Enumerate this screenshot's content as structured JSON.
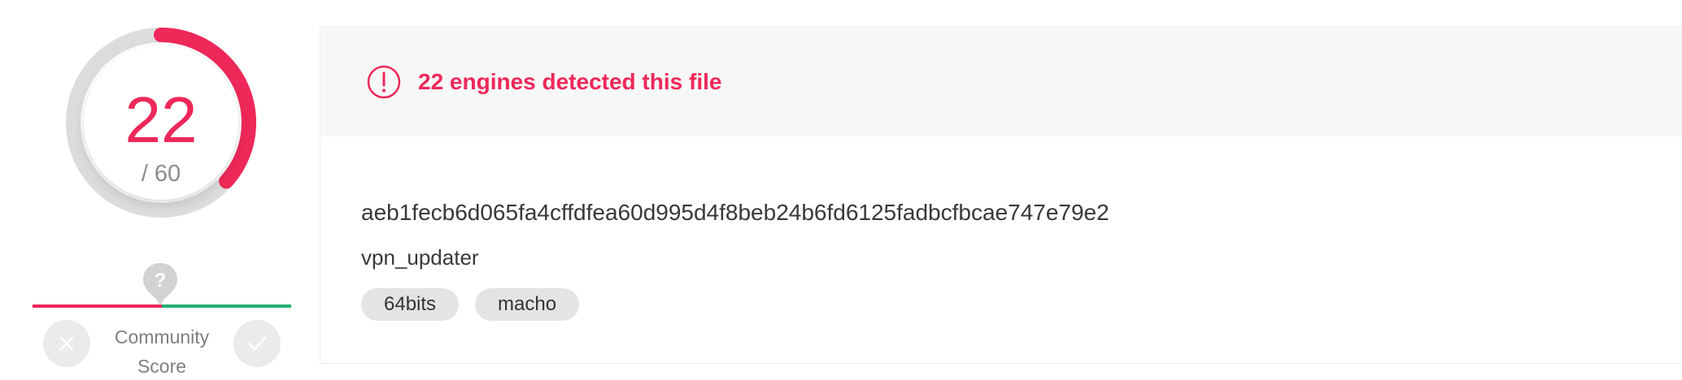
{
  "colors": {
    "danger": "#ee2859",
    "safe": "#21b26f",
    "gauge_track": "#dcdcdc",
    "card_header_bg": "#f7f7f7",
    "tag_bg": "#e4e4e4"
  },
  "detection_score": {
    "detected": "22",
    "total_label": "/ 60",
    "detected_count": 22,
    "total_count": 60
  },
  "community_score": {
    "label": "Community Score",
    "marker_symbol": "?",
    "marker_icon": "question-marker-icon",
    "downvote_icon": "x-icon",
    "upvote_icon": "check-icon"
  },
  "detection_summary": {
    "alert_icon": "exclamation-circle-icon",
    "message": "22 engines detected this file"
  },
  "file": {
    "sha256": "aeb1fecb6d065fa4cffdfea60d995d4f8beb24b6fd6125fadbcfbcae747e79e2",
    "name": "vpn_updater",
    "tags": [
      "64bits",
      "macho"
    ]
  }
}
